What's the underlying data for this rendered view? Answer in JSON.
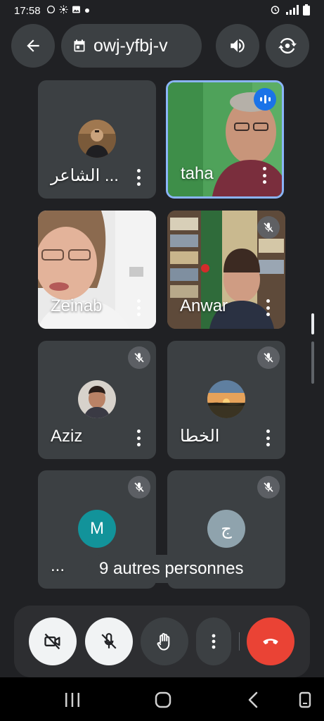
{
  "status_bar": {
    "time": "17:58",
    "left_icons": [
      "whatsapp-icon",
      "sun-icon",
      "image-icon",
      "dot-icon"
    ],
    "right_icons": [
      "alarm-icon",
      "signal-icon",
      "battery-icon"
    ]
  },
  "top_bar": {
    "meeting_code": "owj-yfbj-v"
  },
  "participants": [
    {
      "name": "الشاعر ...",
      "kind": "photo-avatar",
      "muted": false
    },
    {
      "name": "taha",
      "kind": "video",
      "speaking": true,
      "muted": false
    },
    {
      "name": "Zeinab",
      "kind": "video",
      "muted": false
    },
    {
      "name": "Anwar",
      "kind": "video",
      "muted": true
    },
    {
      "name": "Aziz",
      "kind": "photo-avatar",
      "muted": true
    },
    {
      "name": "الخطا",
      "kind": "photo-avatar",
      "muted": true
    },
    {
      "name": "...",
      "kind": "letter-avatar",
      "letter": "M",
      "avatar_color": "#12939a",
      "muted": true
    },
    {
      "name": "",
      "kind": "letter-avatar",
      "letter": "ج",
      "avatar_color": "#8fa3ad",
      "muted": true
    }
  ],
  "others_chip": "9 autres personnes",
  "controls": {
    "end_call_color": "#ea4335"
  },
  "colors": {
    "background": "#202124",
    "tile": "#3c4043",
    "active_border": "#8ab4f8",
    "speaking_badge": "#1a73e8"
  }
}
